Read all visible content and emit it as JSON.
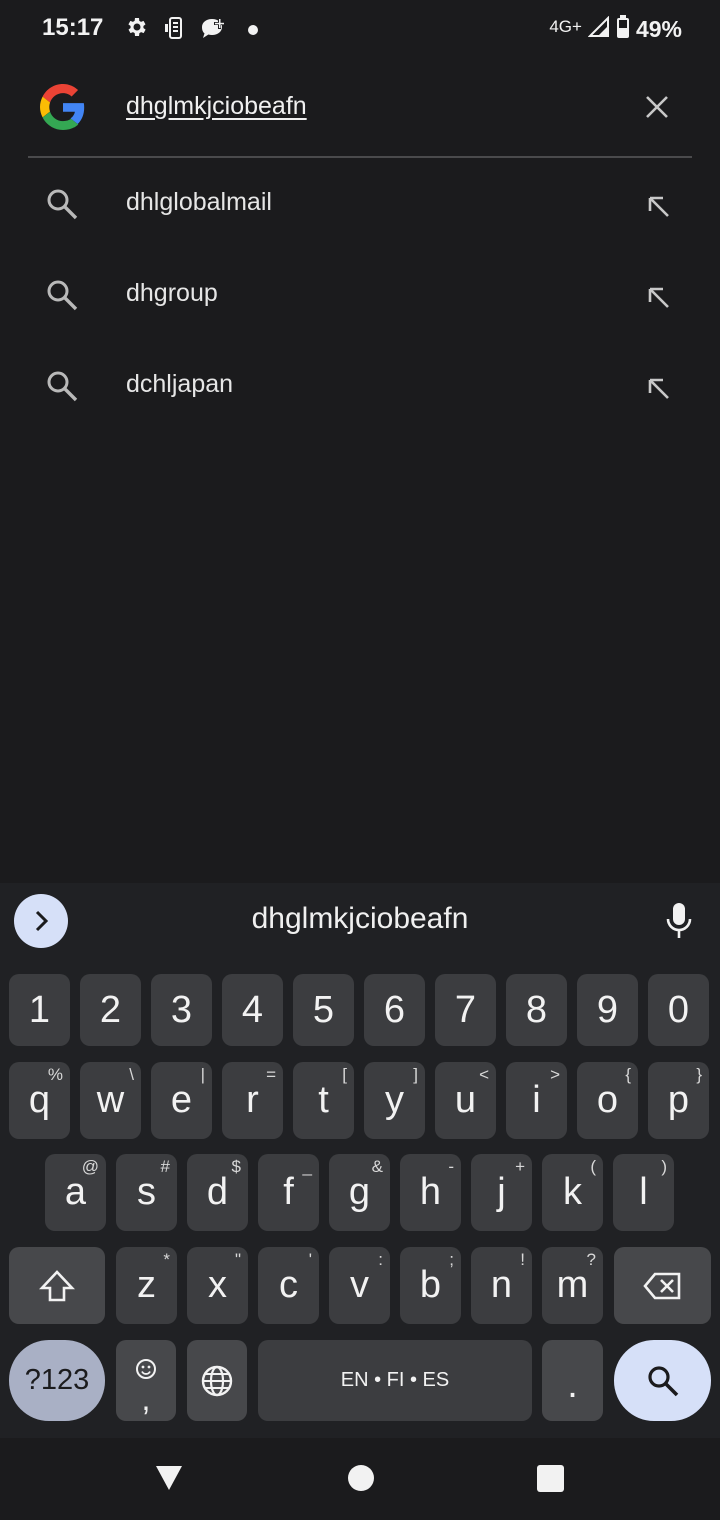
{
  "status_bar": {
    "time": "15:17",
    "left_icons": [
      "gear-icon",
      "phone-link-icon",
      "chat-plus-icon",
      "dot-icon"
    ],
    "network": "4G+",
    "battery": "49%"
  },
  "search": {
    "query": "dhglmkjciobeafn",
    "clear_icon": "close-icon",
    "logo": "google-logo"
  },
  "suggestions": [
    {
      "label": "dhlglobalmail"
    },
    {
      "label": "dhgroup"
    },
    {
      "label": "dchljapan"
    }
  ],
  "keyboard": {
    "suggestion": "dhglmkjciobeafn",
    "numbers": [
      "1",
      "2",
      "3",
      "4",
      "5",
      "6",
      "7",
      "8",
      "9",
      "0"
    ],
    "row1": [
      {
        "k": "q",
        "h": "%"
      },
      {
        "k": "w",
        "h": "\\"
      },
      {
        "k": "e",
        "h": "|"
      },
      {
        "k": "r",
        "h": "="
      },
      {
        "k": "t",
        "h": "["
      },
      {
        "k": "y",
        "h": "]"
      },
      {
        "k": "u",
        "h": "<"
      },
      {
        "k": "i",
        "h": ">"
      },
      {
        "k": "o",
        "h": "{"
      },
      {
        "k": "p",
        "h": "}"
      }
    ],
    "row2": [
      {
        "k": "a",
        "h": "@"
      },
      {
        "k": "s",
        "h": "#"
      },
      {
        "k": "d",
        "h": "$"
      },
      {
        "k": "f",
        "h": "_"
      },
      {
        "k": "g",
        "h": "&"
      },
      {
        "k": "h",
        "h": "-"
      },
      {
        "k": "j",
        "h": "+"
      },
      {
        "k": "k",
        "h": "("
      },
      {
        "k": "l",
        "h": ")"
      }
    ],
    "row3": [
      {
        "k": "z",
        "h": "*"
      },
      {
        "k": "x",
        "h": "\""
      },
      {
        "k": "c",
        "h": "'"
      },
      {
        "k": "v",
        "h": ":"
      },
      {
        "k": "b",
        "h": ";"
      },
      {
        "k": "n",
        "h": "!"
      },
      {
        "k": "m",
        "h": "?"
      }
    ],
    "symbols_label": "?123",
    "comma_label": ",",
    "space_label": "EN • FI • ES",
    "period_label": ".",
    "accent_color": "#d6e0f8"
  }
}
